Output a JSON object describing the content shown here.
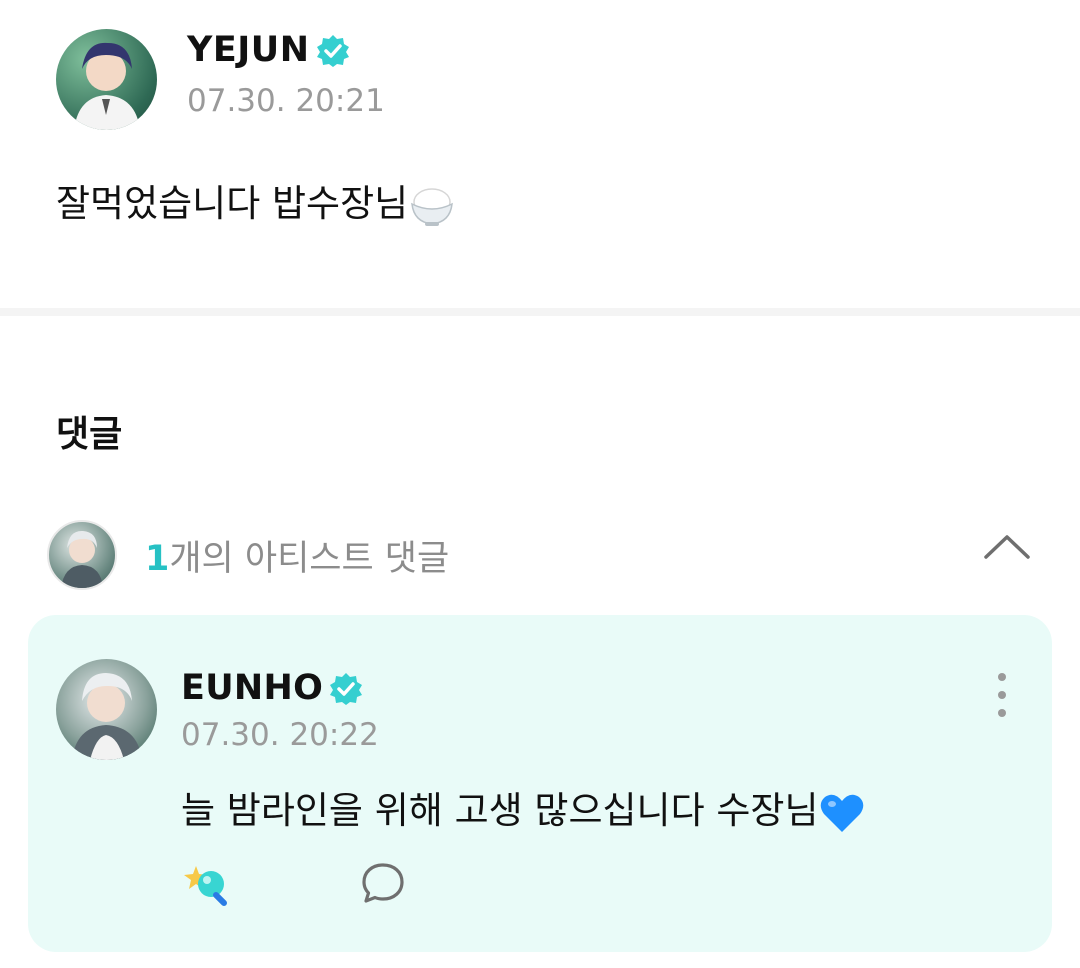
{
  "post": {
    "author": "YEJUN",
    "timestamp": "07.30. 20:21",
    "body_text": "잘먹었습니다 밥수장님"
  },
  "comments_section": {
    "title": "댓글",
    "artist_summary": {
      "count": "1",
      "label": "개의 아티스트 댓글"
    }
  },
  "comment": {
    "author": "EUNHO",
    "timestamp": "07.30. 20:22",
    "body_text": "늘 밤라인을 위해 고생 많으십니다 수장님"
  },
  "colors": {
    "accent": "#26c1c4",
    "verified_badge": "#35cfd0",
    "card_background": "#e9fbf8",
    "heart": "#1e90ff"
  },
  "icons": {
    "verified": "verified-badge-icon",
    "rice_bowl": "rice-bowl-emoji",
    "blue_heart": "blue-heart-emoji",
    "collapse": "chevron-up-icon",
    "more": "more-vertical-icon",
    "reaction": "reaction-icon",
    "reply": "comment-bubble-icon"
  }
}
